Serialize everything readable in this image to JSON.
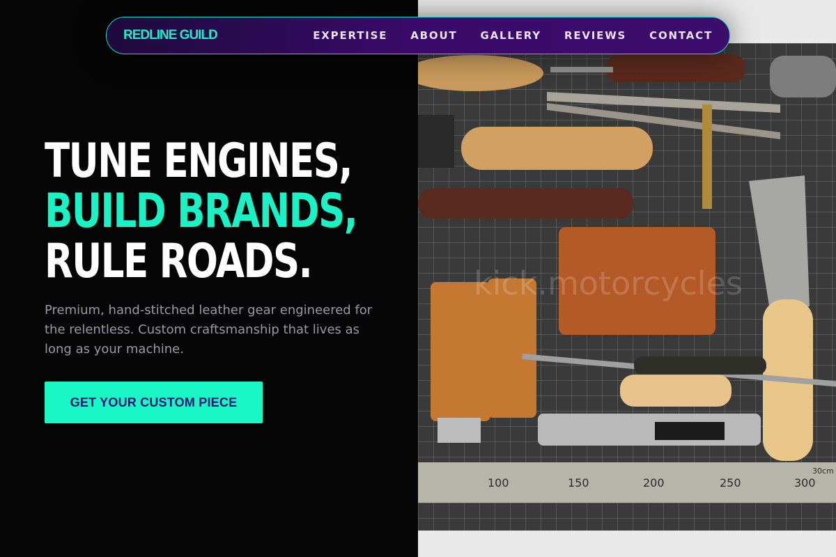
{
  "nav": {
    "brand": "REDLINE GUILD",
    "links": [
      "EXPERTISE",
      "ABOUT",
      "GALLERY",
      "REVIEWS",
      "CONTACT"
    ]
  },
  "hero": {
    "line1": "TUNE ENGINES,",
    "line2": "BUILD BRANDS,",
    "line3": "RULE ROADS.",
    "description": "Premium, hand-stitched leather gear engineered for the relentless. Custom craftsmanship that lives as long as your machine.",
    "cta_label": "GET YOUR CUSTOM PIECE"
  },
  "photo": {
    "watermark": "kick.motorcycles",
    "ruler_numbers": [
      "100",
      "150",
      "200",
      "250",
      "300"
    ],
    "ruler_unit": "30cm"
  },
  "colors": {
    "accent": "#1af2c6",
    "nav_bg": "#3a0a6a",
    "background": "#050505",
    "cta_text": "#1c1670"
  }
}
